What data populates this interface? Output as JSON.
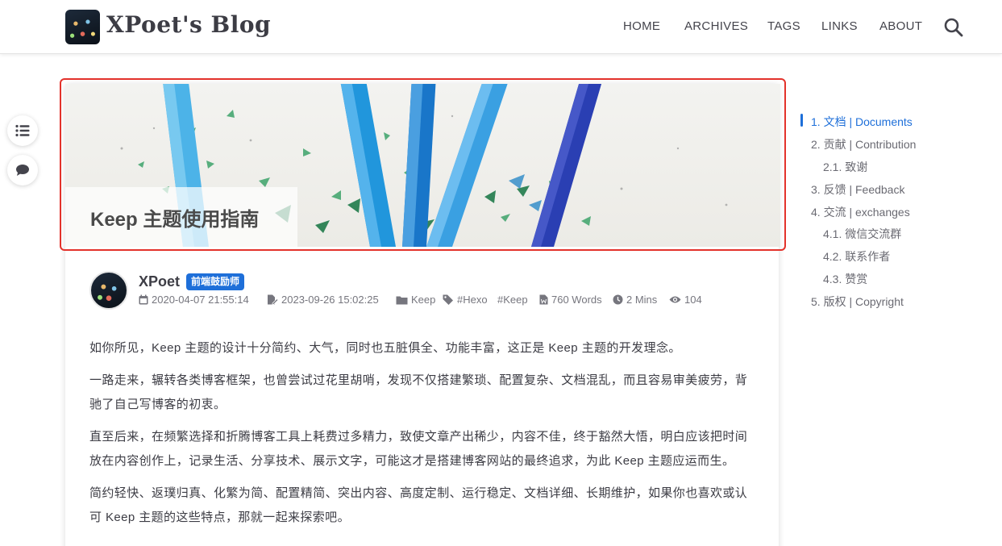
{
  "header": {
    "site_title": "XPoet's Blog",
    "nav": [
      "HOME",
      "ARCHIVES",
      "TAGS",
      "LINKS",
      "ABOUT"
    ]
  },
  "left_tools": [
    {
      "icon": "list-icon"
    },
    {
      "icon": "comment-icon"
    }
  ],
  "article": {
    "title": "Keep 主题使用指南",
    "author": {
      "name": "XPoet",
      "badge": "前端鼓励师"
    },
    "meta": {
      "created": "2020-04-07 21:55:14",
      "updated": "2023-09-26 15:02:25",
      "category": "Keep",
      "tags": [
        "#Hexo",
        "#Keep"
      ],
      "words": "760 Words",
      "read_time": "2 Mins",
      "views": "104"
    },
    "paragraphs": [
      "如你所见，Keep 主题的设计十分简约、大气，同时也五脏俱全、功能丰富，这正是 Keep 主题的开发理念。",
      "一路走来，辗转各类博客框架，也曾尝试过花里胡哨，发现不仅搭建繁琐、配置复杂、文档混乱，而且容易审美疲劳，背驰了自己写博客的初衷。",
      "直至后来，在频繁选择和折腾博客工具上耗费过多精力，致使文章产出稀少，内容不佳，终于豁然大悟，明白应该把时间放在内容创作上，记录生活、分享技术、展示文字，可能这才是搭建博客网站的最终追求，为此 Keep 主题应运而生。",
      "简约轻快、返璞归真、化繁为简、配置精简、突出内容、高度定制、运行稳定、文档详细、长期维护，如果你也喜欢或认可 Keep 主题的这些特点，那就一起来探索吧。"
    ]
  },
  "toc": [
    {
      "label": "1. 文档 | Documents",
      "active": true
    },
    {
      "label": "2. 贡献 | Contribution",
      "active": false
    },
    {
      "label": "2.1. 致谢",
      "active": false
    },
    {
      "label": "3. 反馈 | Feedback",
      "active": false
    },
    {
      "label": "4. 交流 | exchanges",
      "active": false
    },
    {
      "label": "4.1. 微信交流群",
      "active": false
    },
    {
      "label": "4.2. 联系作者",
      "active": false
    },
    {
      "label": "4.3. 赞赏",
      "active": false
    },
    {
      "label": "5. 版权 | Copyright",
      "active": false
    }
  ],
  "colors": {
    "accent": "#1e6fd9",
    "highlight_outline": "#e3322b"
  }
}
